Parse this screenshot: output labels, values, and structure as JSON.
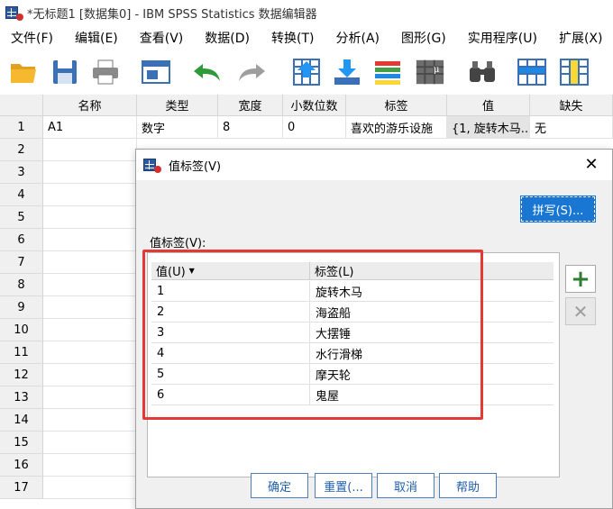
{
  "window": {
    "title": "*无标题1 [数据集0] - IBM SPSS Statistics 数据编辑器"
  },
  "menubar": [
    "文件(F)",
    "编辑(E)",
    "查看(V)",
    "数据(D)",
    "转换(T)",
    "分析(A)",
    "图形(G)",
    "实用程序(U)",
    "扩展(X)"
  ],
  "toolbar": [
    "open-folder-icon",
    "save-icon",
    "print-icon",
    "dialog-recall-icon",
    "undo-icon",
    "redo-icon",
    "goto-case-icon",
    "goto-variable-icon",
    "variables-icon",
    "run-descriptives-icon",
    "find-icon",
    "insert-cases-icon",
    "insert-variable-icon"
  ],
  "grid": {
    "columns": [
      "名称",
      "类型",
      "宽度",
      "小数位数",
      "标签",
      "值",
      "缺失"
    ],
    "rows": [
      "1",
      "2",
      "3",
      "4",
      "5",
      "6",
      "7",
      "8",
      "9",
      "10",
      "11",
      "12",
      "13",
      "14",
      "15",
      "16",
      "17"
    ],
    "row1": [
      "A1",
      "数字",
      "8",
      "0",
      "喜欢的游乐设施",
      "{1, 旋转木马...",
      "无"
    ]
  },
  "dialog": {
    "title": "值标签(V)",
    "spell_button": "拼写(S)...",
    "value_labels_label": "值标签(V):",
    "table_headers": {
      "value": "值(U)",
      "label": "标签(L)"
    },
    "entries": [
      {
        "value": "1",
        "label": "旋转木马"
      },
      {
        "value": "2",
        "label": "海盗船"
      },
      {
        "value": "3",
        "label": "大摆锤"
      },
      {
        "value": "4",
        "label": "水行滑梯"
      },
      {
        "value": "5",
        "label": "摩天轮"
      },
      {
        "value": "6",
        "label": "鬼屋"
      }
    ],
    "buttons": {
      "ok": "确定",
      "reset": "重置(...",
      "cancel": "取消",
      "help": "帮助"
    }
  },
  "colors": {
    "accent": "#1976d2",
    "highlight_border": "#e53935",
    "add_icon": "#2e7d32"
  }
}
